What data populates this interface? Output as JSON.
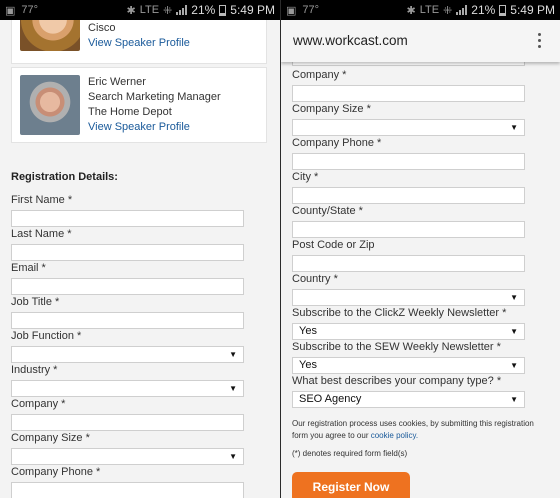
{
  "status_bar": {
    "carrier_label": "77°",
    "network": "LTE",
    "battery": "21%",
    "time": "5:49 PM"
  },
  "left": {
    "speaker_1": {
      "company": "Cisco",
      "link": "View Speaker Profile"
    },
    "speaker_2": {
      "name": "Eric Werner",
      "title": "Search Marketing Manager",
      "company": "The Home Depot",
      "link": "View Speaker Profile"
    },
    "section_title": "Registration Details:",
    "fields": [
      {
        "label": "First Name *",
        "type": "text",
        "value": ""
      },
      {
        "label": "Last Name *",
        "type": "text",
        "value": ""
      },
      {
        "label": "Email *",
        "type": "text",
        "value": ""
      },
      {
        "label": "Job Title *",
        "type": "text",
        "value": ""
      },
      {
        "label": "Job Function *",
        "type": "select",
        "value": ""
      },
      {
        "label": "Industry *",
        "type": "select",
        "value": ""
      },
      {
        "label": "Company *",
        "type": "text",
        "value": ""
      },
      {
        "label": "Company Size *",
        "type": "select",
        "value": ""
      },
      {
        "label": "Company Phone *",
        "type": "text",
        "value": ""
      }
    ]
  },
  "right": {
    "url": "www.workcast.com",
    "fields": [
      {
        "label": "Company *",
        "type": "text",
        "value": ""
      },
      {
        "label": "Company Size *",
        "type": "select",
        "value": ""
      },
      {
        "label": "Company Phone *",
        "type": "text",
        "value": ""
      },
      {
        "label": "City *",
        "type": "text",
        "value": ""
      },
      {
        "label": "County/State *",
        "type": "text",
        "value": ""
      },
      {
        "label": "Post Code or Zip",
        "type": "text",
        "value": ""
      },
      {
        "label": "Country *",
        "type": "select",
        "value": ""
      },
      {
        "label": "Subscribe to the ClickZ Weekly Newsletter *",
        "type": "select",
        "value": "Yes"
      },
      {
        "label": "Subscribe to the SEW Weekly Newsletter *",
        "type": "select",
        "value": "Yes"
      },
      {
        "label": "What best describes your company type? *",
        "type": "select",
        "value": "SEO Agency"
      }
    ],
    "notice_text": "Our registration process uses cookies, by submitting this registration form you agree to our",
    "notice_link": "cookie policy.",
    "required_note": "(*) denotes required form field(s)",
    "submit_label": "Register Now"
  }
}
